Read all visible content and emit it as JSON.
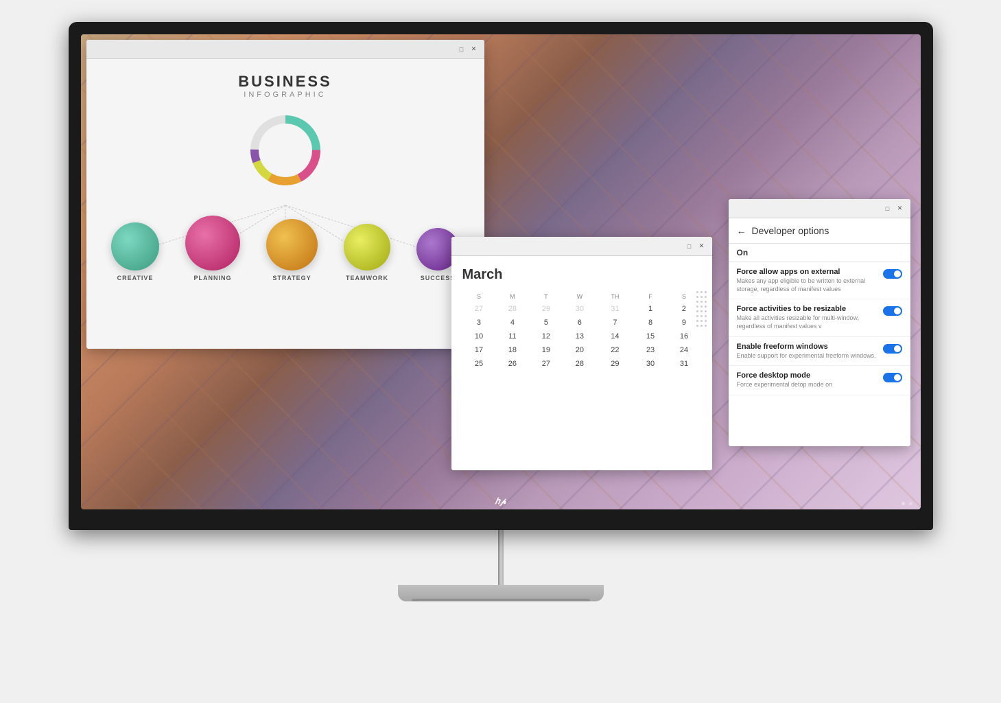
{
  "monitor": {
    "brand": "hp",
    "brand_symbol": "ℎ𝑝"
  },
  "infographic_window": {
    "title": "Business Infographic",
    "title_main": "BUSINESS",
    "title_sub": "INFOGRAPHIC",
    "labels": [
      "CREATIVE",
      "PLANNING",
      "STRATEGY",
      "TEAMWORK",
      "SUCCESS"
    ],
    "bubble_colors": [
      "#5bc8b0",
      "#d94f8a",
      "#e8a030",
      "#d4d840",
      "#8855aa"
    ],
    "bubble_sizes": [
      70,
      80,
      75,
      68,
      62
    ],
    "window_buttons": [
      "□",
      "✕"
    ]
  },
  "calendar_window": {
    "month": "March",
    "days_header": [
      "S",
      "M",
      "T",
      "W",
      "TH",
      "F",
      "S"
    ],
    "weeks": [
      [
        "27",
        "28",
        "29",
        "30",
        "31",
        "1",
        "2"
      ],
      [
        "3",
        "4",
        "5",
        "6",
        "7",
        "8",
        "9"
      ],
      [
        "10",
        "11",
        "12",
        "13",
        "14",
        "15",
        "16"
      ],
      [
        "17",
        "18",
        "19",
        "20",
        "22",
        "23",
        "24"
      ],
      [
        "25",
        "26",
        "27",
        "28",
        "29",
        "30",
        "31"
      ]
    ],
    "window_buttons": [
      "□",
      "✕"
    ]
  },
  "developer_window": {
    "title": "Developer options",
    "status": "On",
    "back_arrow": "←",
    "window_buttons": [
      "□",
      "✕"
    ],
    "options": [
      {
        "title": "Force allow apps on external",
        "desc": "Makes any app eligible to be written to external storage, regardless of manifest values"
      },
      {
        "title": "Force activities to be resizable",
        "desc": "Make all activities resizable for multi-window, regardless of manifest values v"
      },
      {
        "title": "Enable freeform windows",
        "desc": "Enable support for experimental freeform windows."
      },
      {
        "title": "Force desktop mode",
        "desc": "Force experimental detop mode on"
      }
    ]
  }
}
